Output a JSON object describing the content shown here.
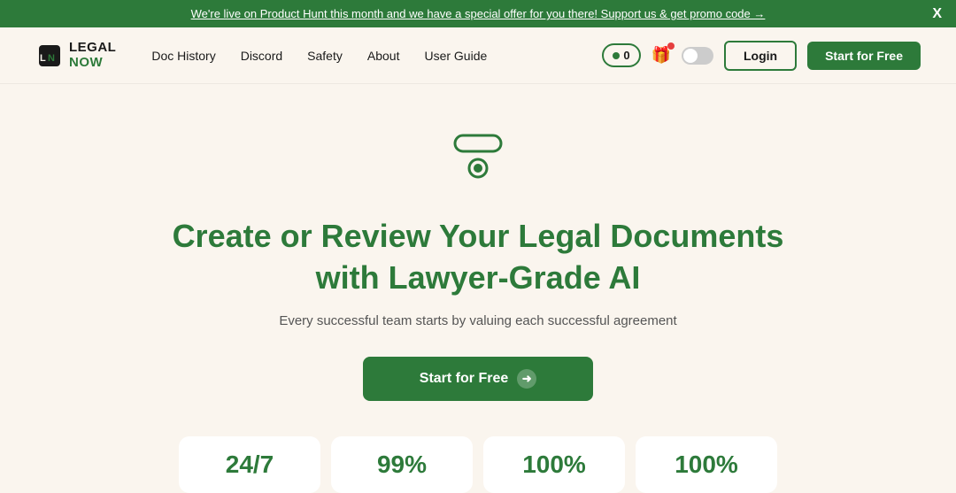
{
  "banner": {
    "text": "We're live on Product Hunt this month and we have a special offer for you there! Support us & get promo code →",
    "close_label": "X"
  },
  "nav": {
    "logo_line1": "LEGAL",
    "logo_line2": "NOW",
    "links": [
      {
        "label": "Doc History",
        "id": "doc-history"
      },
      {
        "label": "Discord",
        "id": "discord"
      },
      {
        "label": "Safety",
        "id": "safety"
      },
      {
        "label": "About",
        "id": "about"
      },
      {
        "label": "User Guide",
        "id": "user-guide"
      }
    ],
    "counter": "0",
    "login_label": "Login",
    "start_label": "Start for Free"
  },
  "hero": {
    "title_line1": "Create or Review Your Legal Documents",
    "title_line2": "with Lawyer-Grade AI",
    "subtitle": "Every successful team starts by valuing each successful agreement",
    "cta_label": "Start for Free"
  },
  "stats": [
    {
      "value": "24/7"
    },
    {
      "value": "99%"
    },
    {
      "value": "100%"
    },
    {
      "value": "100%"
    }
  ]
}
